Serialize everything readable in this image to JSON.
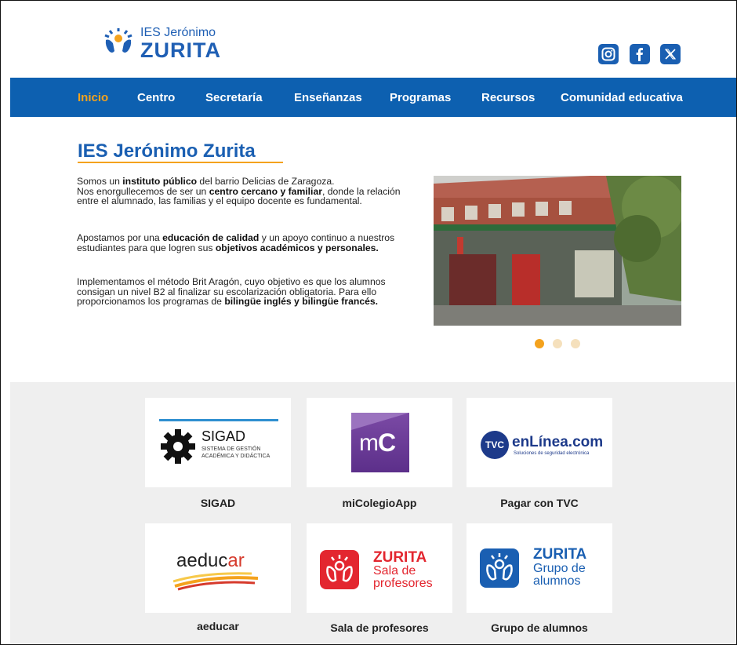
{
  "header": {
    "logo_small": "IES Jerónimo",
    "logo_big": "ZURITA",
    "social": [
      {
        "name": "instagram",
        "icon": "instagram-icon"
      },
      {
        "name": "facebook",
        "icon": "facebook-icon"
      },
      {
        "name": "x",
        "icon": "x-icon"
      }
    ]
  },
  "nav": {
    "items": [
      {
        "label": "Inicio",
        "active": true
      },
      {
        "label": "Centro"
      },
      {
        "label": "Secretaría"
      },
      {
        "label": "Enseñanzas"
      },
      {
        "label": "Programas"
      },
      {
        "label": "Recursos"
      },
      {
        "label": "Comunidad educativa"
      }
    ]
  },
  "intro": {
    "title": "IES Jerónimo Zurita",
    "p1": {
      "a": "Somos un ",
      "b": "instituto público",
      "c": " del barrio Delicias de Zaragoza.",
      "d": "Nos enorgullecemos de ser un ",
      "e": "centro cercano y familiar",
      "f": ", donde la relación entre el alumnado, las familias y el equipo docente es fundamental."
    },
    "p2": {
      "a": "Apostamos por una ",
      "b": "educación de calidad",
      "c": " y un apoyo continuo a nuestros estudiantes para que logren sus ",
      "d": "objetivos académicos y personales."
    },
    "p3": {
      "a": "Implementamos el método Brit Aragón, cuyo objetivo es que los alumnos consigan un nivel B2 al finalizar su escolarización obligatoria. Para ello proporcionamos los programas de ",
      "b": "bilingüe inglés y bilingüe francés."
    },
    "carousel": {
      "slides": 3,
      "active": 1
    }
  },
  "colors": {
    "brand_blue": "#0d60b0",
    "accent_orange": "#f4a21d",
    "grey_bg": "#efefef"
  },
  "cards": [
    {
      "label": "SIGAD",
      "logo_title": "SIGAD",
      "logo_sub1": "SISTEMA DE GESTIÓN",
      "logo_sub2": "ACADÉMICA Y DIDÁCTICA"
    },
    {
      "label": "miColegioApp",
      "logo_text_m": "m",
      "logo_text_c": "C"
    },
    {
      "label": "Pagar con TVC",
      "logo_badge": "TVC",
      "logo_title": "enLínea.com",
      "logo_sub": "Soluciones de seguridad electrónica"
    },
    {
      "label": "aeducar",
      "logo_a": "aeduc",
      "logo_b": "ar"
    },
    {
      "label": "Sala de profesores",
      "logo_title": "ZURITA",
      "logo_l1": "Sala de",
      "logo_l2": "profesores"
    },
    {
      "label": "Grupo de alumnos",
      "logo_title": "ZURITA",
      "logo_l1": "Grupo de",
      "logo_l2": "alumnos"
    }
  ]
}
